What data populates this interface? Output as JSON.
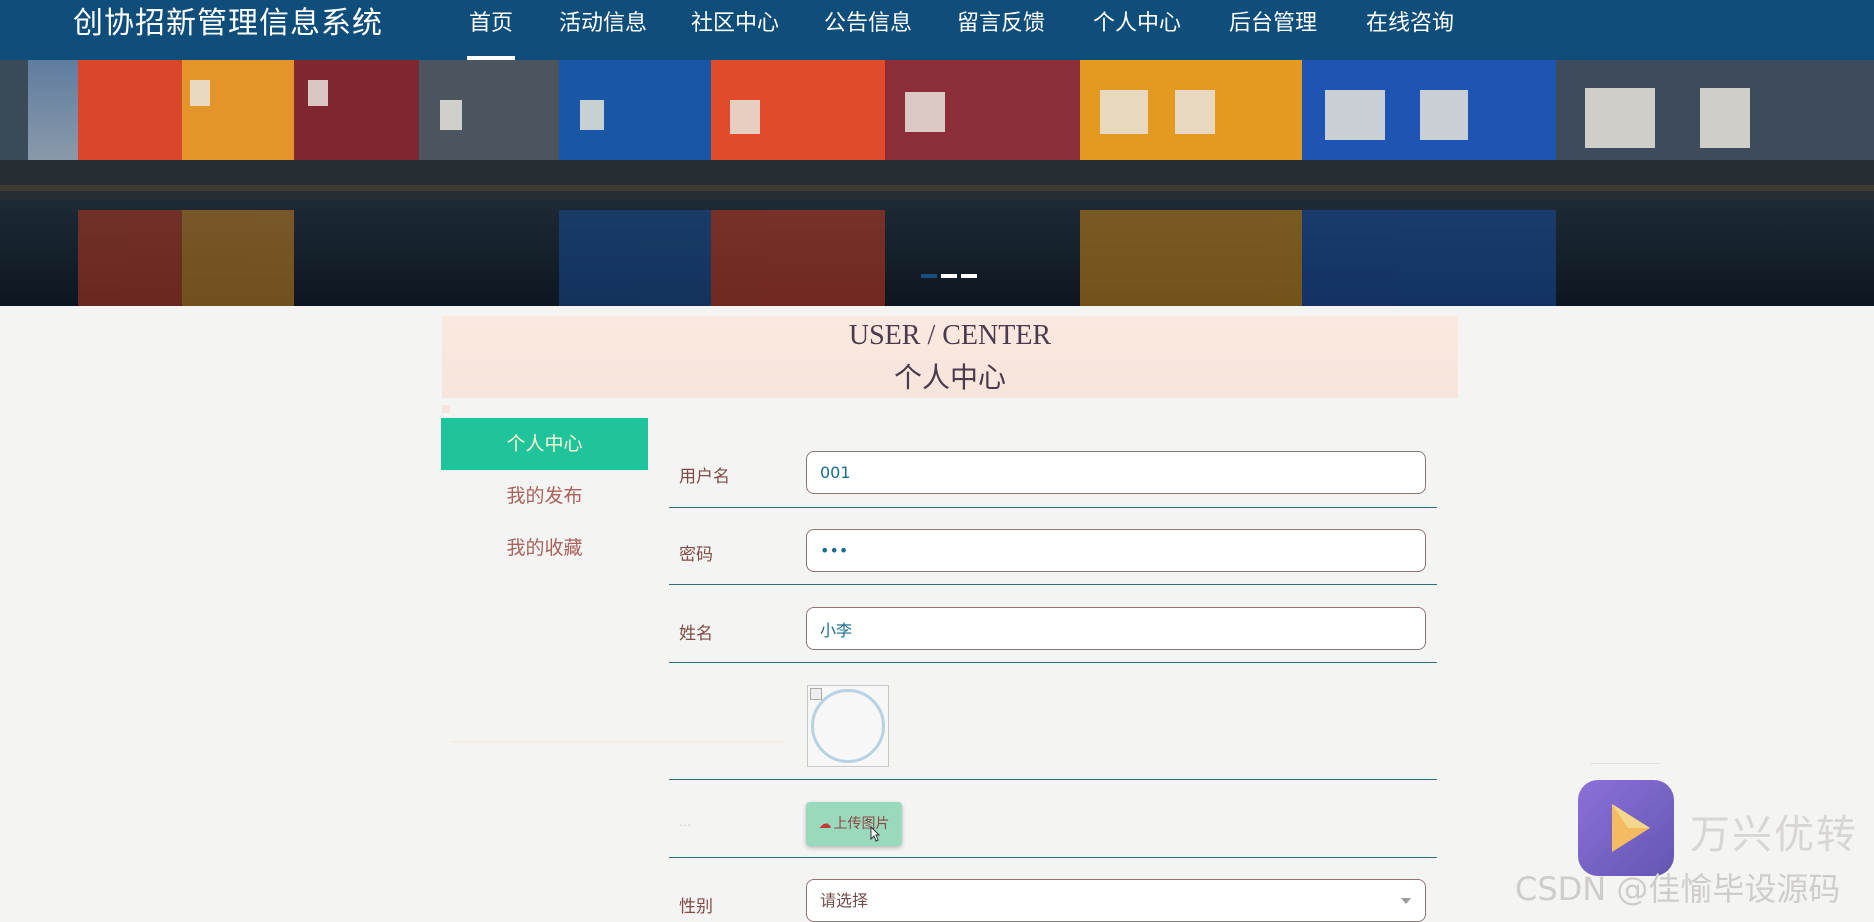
{
  "app": {
    "title": "创协招新管理信息系统"
  },
  "nav": {
    "items": [
      {
        "label": "首页",
        "active": true
      },
      {
        "label": "活动信息",
        "active": false
      },
      {
        "label": "社区中心",
        "active": false
      },
      {
        "label": "公告信息",
        "active": false
      },
      {
        "label": "留言反馈",
        "active": false
      },
      {
        "label": "个人中心",
        "active": false
      },
      {
        "label": "后台管理",
        "active": false
      },
      {
        "label": "在线咨询",
        "active": false
      }
    ]
  },
  "banner": {
    "slide_count": 3,
    "active_slide": 2
  },
  "section": {
    "title_en": "USER / CENTER",
    "title_cn": "个人中心"
  },
  "sidebar": {
    "items": [
      {
        "label": "个人中心",
        "active": true
      },
      {
        "label": "我的发布",
        "active": false
      },
      {
        "label": "我的收藏",
        "active": false
      }
    ]
  },
  "form": {
    "username": {
      "label": "用户名",
      "value": "001"
    },
    "password": {
      "label": "密码",
      "value": "•••"
    },
    "name": {
      "label": "姓名",
      "value": "小李"
    },
    "upload": {
      "label": "上传图片",
      "icon": "cloud-upload-icon"
    },
    "gender": {
      "label": "性别",
      "placeholder": "请选择"
    }
  },
  "watermark": {
    "brand": "万兴优转",
    "credit": "CSDN @佳愉毕设源码"
  },
  "colors": {
    "nav_bg": "#0f4d7a",
    "active_tab": "#1fc49a",
    "label_text": "#7f4b46",
    "input_text": "#1a6c8f",
    "upload_button": "#9bd9bd"
  }
}
